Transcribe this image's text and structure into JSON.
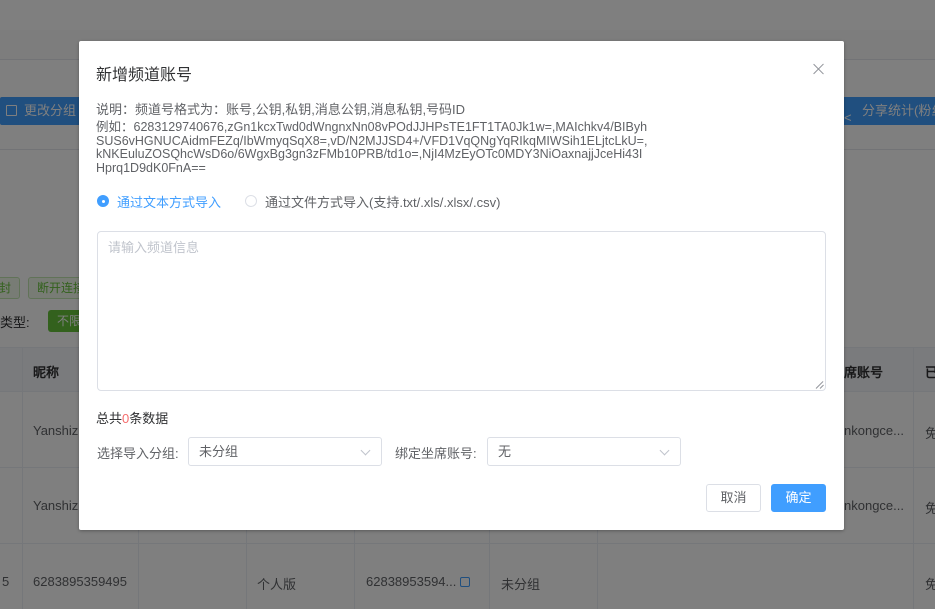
{
  "background": {
    "toolbar": {
      "change_group_label": "更改分组",
      "share_stats_label": "分享统计(粉丝"
    },
    "tags": {
      "seal_label": "封",
      "disconnect_label": "断开连接"
    },
    "filter": {
      "type_label": "类型:",
      "type_chip": "不限"
    },
    "table": {
      "headers": {
        "nickname": "昵称",
        "seat_account": "席账号",
        "last_col": "已"
      },
      "rows": [
        {
          "nickname": "Yanshizl",
          "seat": "nkongce...",
          "last": "免"
        },
        {
          "nickname": "Yanshizl",
          "seat": "nkongce...",
          "last": "免"
        },
        {
          "index": "5",
          "nickname": "6283895359495",
          "edition": "个人版",
          "account": "62838953594...",
          "group": "未分组",
          "last": "免"
        }
      ]
    }
  },
  "dialog": {
    "title": "新增频道账号",
    "description": "说明：频道号格式为：账号,公钥,私钥,消息公钥,消息私钥,号码ID",
    "example_lines": [
      "例如：6283129740676,zGn1kcxTwd0dWngnxNn08vPOdJJHPsTE1FT1TA0Jk1w=,MAIchkv4/BIByh",
      "SUS6vHGNUCAidmFEZq/IbWmyqSqX8=,vD/N2MJJSD4+/VFD1VqQNgYqRIkqMIWSih1ELjtcLkU=,",
      "kNKEuluZOSQhcWsD6o/6WgxBg3gn3zFMb10PRB/td1o=,NjI4MzEyOTc0MDY3NiOaxnajjJceHi43I",
      "Hprq1D9dK0FnA=="
    ],
    "import_mode": {
      "text_option": "通过文本方式导入",
      "file_option": "通过文件方式导入(支持.txt/.xls/.xlsx/.csv)",
      "selected": "text"
    },
    "textarea": {
      "placeholder": "请输入频道信息",
      "value": ""
    },
    "count": {
      "prefix": "总共",
      "value": "0",
      "suffix": "条数据"
    },
    "group_select": {
      "label": "选择导入分组:",
      "value": "未分组"
    },
    "seat_select": {
      "label": "绑定坐席账号:",
      "value": "无"
    },
    "buttons": {
      "cancel": "取消",
      "confirm": "确定"
    }
  },
  "colors": {
    "primary": "#409eff",
    "success": "#67c23a",
    "danger": "#f56c6c",
    "overlay": "rgba(0,0,0,0.5)"
  }
}
